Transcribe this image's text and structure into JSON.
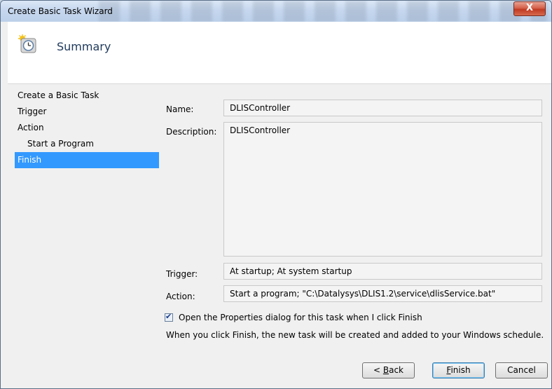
{
  "window": {
    "title": "Create Basic Task Wizard",
    "close_label": "X"
  },
  "header": {
    "title": "Summary",
    "icon": "clock-sun-icon"
  },
  "nav": {
    "items": [
      {
        "label": "Create a Basic Task",
        "sub": false,
        "selected": false
      },
      {
        "label": "Trigger",
        "sub": false,
        "selected": false
      },
      {
        "label": "Action",
        "sub": false,
        "selected": false
      },
      {
        "label": "Start a Program",
        "sub": true,
        "selected": false
      },
      {
        "label": "Finish",
        "sub": false,
        "selected": true
      }
    ]
  },
  "summary": {
    "name_label": "Name:",
    "name_value": "DLISController",
    "description_label": "Description:",
    "description_value": "DLISController",
    "trigger_label": "Trigger:",
    "trigger_value": "At startup; At system startup",
    "action_label": "Action:",
    "action_value": "Start a program; \"C:\\Datalysys\\DLIS1.2\\service\\dlisService.bat\""
  },
  "options": {
    "open_properties_label": "Open the Properties dialog for this task when I click Finish",
    "open_properties_checked": true,
    "info_text": "When you click Finish, the new task will be created and added to your Windows schedule."
  },
  "buttons": {
    "back_prefix": "< ",
    "back_hotkey": "B",
    "back_rest": "ack",
    "finish_hotkey": "F",
    "finish_rest": "inish",
    "cancel_label": "Cancel"
  }
}
